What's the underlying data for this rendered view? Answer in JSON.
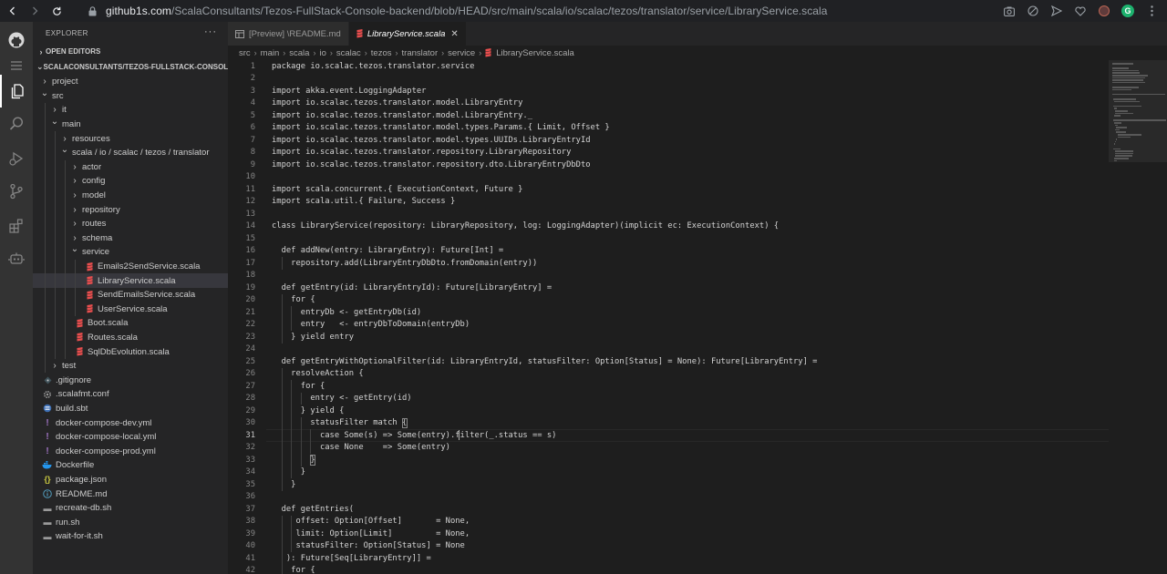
{
  "browser": {
    "url_host": "github1s.com",
    "url_path": "/ScalaConsultants/Tezos-FullStack-Console-backend/blob/HEAD/src/main/scala/io/scalac/tezos/translator/service/LibraryService.scala",
    "extension_green_letter": "G"
  },
  "sidebar": {
    "title": "EXPLORER",
    "open_editors": "OPEN EDITORS",
    "repo_section": "SCALACONSULTANTS/TEZOS-FULLSTACK-CONSOLE...",
    "tree": [
      {
        "label": "project",
        "depth": 0,
        "kind": "folder",
        "open": false
      },
      {
        "label": "src",
        "depth": 0,
        "kind": "folder",
        "open": true
      },
      {
        "label": "it",
        "depth": 1,
        "kind": "folder",
        "open": false
      },
      {
        "label": "main",
        "depth": 1,
        "kind": "folder",
        "open": true
      },
      {
        "label": "resources",
        "depth": 2,
        "kind": "folder",
        "open": false
      },
      {
        "label": "scala / io / scalac / tezos / translator",
        "depth": 2,
        "kind": "folder",
        "open": true
      },
      {
        "label": "actor",
        "depth": 3,
        "kind": "folder",
        "open": false
      },
      {
        "label": "config",
        "depth": 3,
        "kind": "folder",
        "open": false
      },
      {
        "label": "model",
        "depth": 3,
        "kind": "folder",
        "open": false
      },
      {
        "label": "repository",
        "depth": 3,
        "kind": "folder",
        "open": false
      },
      {
        "label": "routes",
        "depth": 3,
        "kind": "folder",
        "open": false
      },
      {
        "label": "schema",
        "depth": 3,
        "kind": "folder",
        "open": false
      },
      {
        "label": "service",
        "depth": 3,
        "kind": "folder",
        "open": true
      },
      {
        "label": "Emails2SendService.scala",
        "depth": 4,
        "kind": "scala"
      },
      {
        "label": "LibraryService.scala",
        "depth": 4,
        "kind": "scala",
        "selected": true
      },
      {
        "label": "SendEmailsService.scala",
        "depth": 4,
        "kind": "scala"
      },
      {
        "label": "UserService.scala",
        "depth": 4,
        "kind": "scala"
      },
      {
        "label": "Boot.scala",
        "depth": 3,
        "kind": "scala"
      },
      {
        "label": "Routes.scala",
        "depth": 3,
        "kind": "scala"
      },
      {
        "label": "SqlDbEvolution.scala",
        "depth": 3,
        "kind": "scala"
      },
      {
        "label": "test",
        "depth": 1,
        "kind": "folder",
        "open": false
      },
      {
        "label": ".gitignore",
        "depth": 0,
        "kind": "gitignore"
      },
      {
        "label": ".scalafmt.conf",
        "depth": 0,
        "kind": "gear"
      },
      {
        "label": "build.sbt",
        "depth": 0,
        "kind": "sbt"
      },
      {
        "label": "docker-compose-dev.yml",
        "depth": 0,
        "kind": "yml"
      },
      {
        "label": "docker-compose-local.yml",
        "depth": 0,
        "kind": "yml"
      },
      {
        "label": "docker-compose-prod.yml",
        "depth": 0,
        "kind": "yml"
      },
      {
        "label": "Dockerfile",
        "depth": 0,
        "kind": "docker"
      },
      {
        "label": "package.json",
        "depth": 0,
        "kind": "json"
      },
      {
        "label": "README.md",
        "depth": 0,
        "kind": "info"
      },
      {
        "label": "recreate-db.sh",
        "depth": 0,
        "kind": "sh"
      },
      {
        "label": "run.sh",
        "depth": 0,
        "kind": "sh"
      },
      {
        "label": "wait-for-it.sh",
        "depth": 0,
        "kind": "sh"
      }
    ]
  },
  "tabs": [
    {
      "label": "[Preview] \\README.md",
      "active": false,
      "icon": "preview-icon"
    },
    {
      "label": "LibraryService.scala",
      "active": true,
      "icon": "scala-icon",
      "close": "✕"
    }
  ],
  "breadcrumbs": [
    "src",
    "main",
    "scala",
    "io",
    "scalac",
    "tezos",
    "translator",
    "service",
    "LibraryService.scala"
  ],
  "editor": {
    "current_line": 31,
    "lines": [
      {
        "n": "1",
        "text": "package io.scalac.tezos.translator.service"
      },
      {
        "n": "2",
        "text": ""
      },
      {
        "n": "3",
        "text": "import akka.event.LoggingAdapter"
      },
      {
        "n": "4",
        "text": "import io.scalac.tezos.translator.model.LibraryEntry"
      },
      {
        "n": "5",
        "text": "import io.scalac.tezos.translator.model.LibraryEntry._"
      },
      {
        "n": "6",
        "text": "import io.scalac.tezos.translator.model.types.Params.{ Limit, Offset }"
      },
      {
        "n": "7",
        "text": "import io.scalac.tezos.translator.model.types.UUIDs.LibraryEntryId"
      },
      {
        "n": "8",
        "text": "import io.scalac.tezos.translator.repository.LibraryRepository"
      },
      {
        "n": "9",
        "text": "import io.scalac.tezos.translator.repository.dto.LibraryEntryDbDto"
      },
      {
        "n": "10",
        "text": ""
      },
      {
        "n": "11",
        "text": "import scala.concurrent.{ ExecutionContext, Future }"
      },
      {
        "n": "12",
        "text": "import scala.util.{ Failure, Success }"
      },
      {
        "n": "13",
        "text": ""
      },
      {
        "n": "14",
        "text": "class LibraryService(repository: LibraryRepository, log: LoggingAdapter)(implicit ec: ExecutionContext) {"
      },
      {
        "n": "15",
        "text": ""
      },
      {
        "n": "16",
        "text": "  def addNew(entry: LibraryEntry): Future[Int] ="
      },
      {
        "n": "17",
        "text": "    repository.add(LibraryEntryDbDto.fromDomain(entry))"
      },
      {
        "n": "18",
        "text": ""
      },
      {
        "n": "19",
        "text": "  def getEntry(id: LibraryEntryId): Future[LibraryEntry] ="
      },
      {
        "n": "20",
        "text": "    for {"
      },
      {
        "n": "21",
        "text": "      entryDb <- getEntryDb(id)"
      },
      {
        "n": "22",
        "text": "      entry   <- entryDbToDomain(entryDb)"
      },
      {
        "n": "23",
        "text": "    } yield entry"
      },
      {
        "n": "24",
        "text": ""
      },
      {
        "n": "25",
        "text": "  def getEntryWithOptionalFilter(id: LibraryEntryId, statusFilter: Option[Status] = None): Future[LibraryEntry] ="
      },
      {
        "n": "26",
        "text": "    resolveAction {"
      },
      {
        "n": "27",
        "text": "      for {"
      },
      {
        "n": "28",
        "text": "        entry <- getEntry(id)"
      },
      {
        "n": "29",
        "text": "      } yield {"
      },
      {
        "n": "30",
        "text": "        statusFilter match {"
      },
      {
        "n": "31",
        "text": "          case Some(s) => Some(entry).filter(_.status == s)"
      },
      {
        "n": "32",
        "text": "          case None    => Some(entry)"
      },
      {
        "n": "33",
        "text": "        }"
      },
      {
        "n": "34",
        "text": "      }"
      },
      {
        "n": "35",
        "text": "    }"
      },
      {
        "n": "36",
        "text": ""
      },
      {
        "n": "37",
        "text": "  def getEntries("
      },
      {
        "n": "38",
        "text": "     offset: Option[Offset]       = None,"
      },
      {
        "n": "39",
        "text": "     limit: Option[Limit]         = None,"
      },
      {
        "n": "40",
        "text": "     statusFilter: Option[Status] = None"
      },
      {
        "n": "41",
        "text": "   ): Future[Seq[LibraryEntry]] ="
      },
      {
        "n": "42",
        "text": "    for {"
      }
    ]
  },
  "colors": {
    "activity_bar": "#333333",
    "sidebar": "#252526",
    "editor": "#1e1e1e",
    "selected_row": "#37373d",
    "scala_icon": "#e84e4e",
    "yml_icon": "#a074c4",
    "json_icon": "#cbcb41",
    "docker_icon": "#2496ed",
    "info_icon": "#519aba"
  }
}
